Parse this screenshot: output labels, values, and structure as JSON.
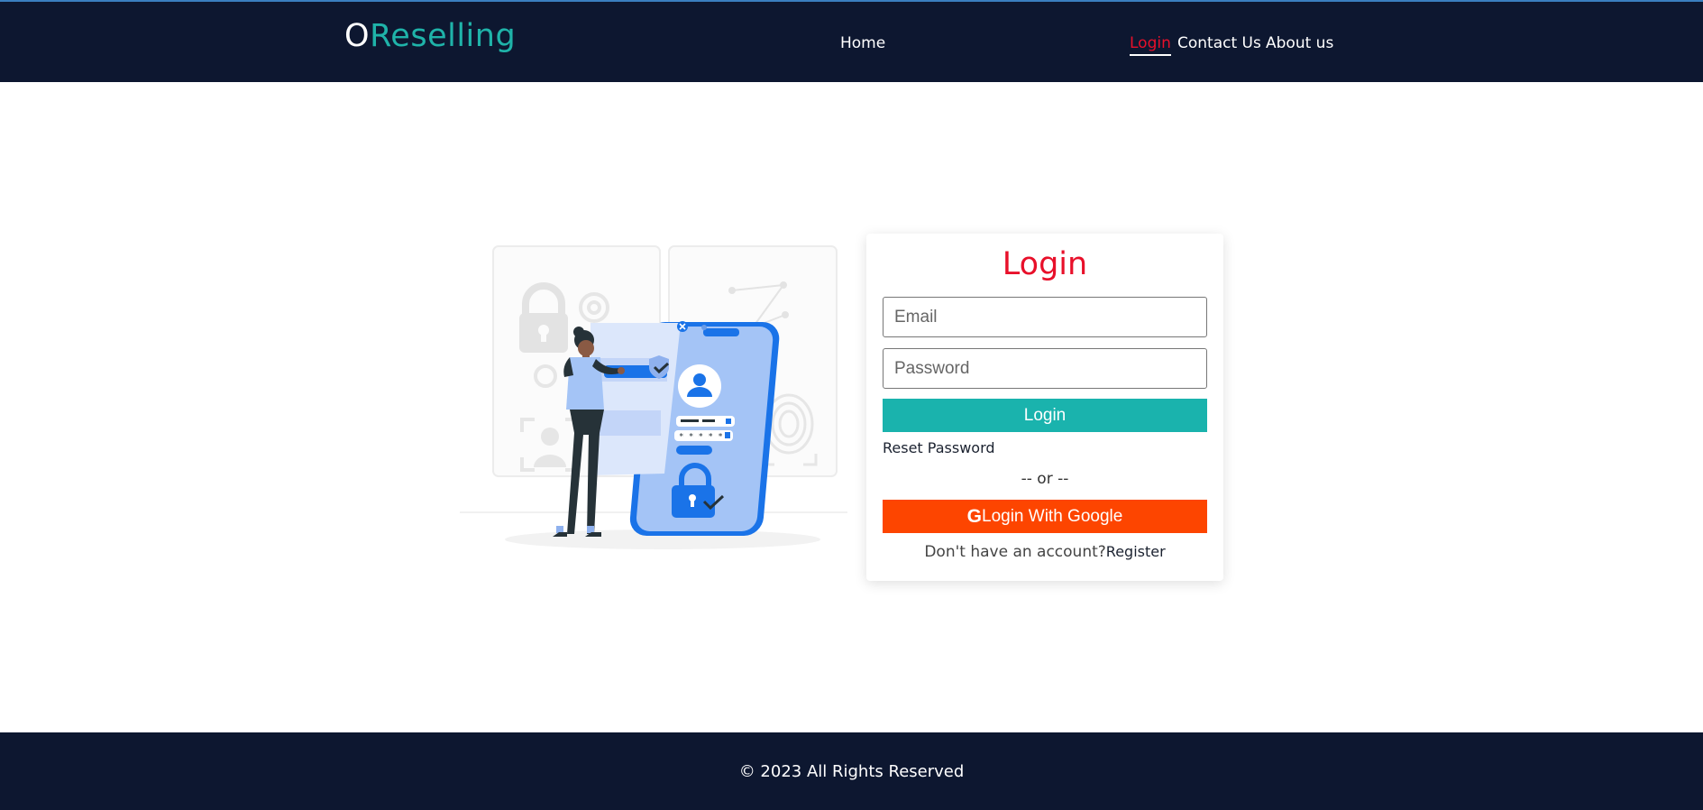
{
  "brand": {
    "first_letter": "O",
    "rest": "Reselling"
  },
  "nav": {
    "home": "Home",
    "login": "Login",
    "contact": "Contact Us",
    "about": "About us"
  },
  "login_card": {
    "title": "Login",
    "email_placeholder": "Email",
    "password_placeholder": "Password",
    "login_button": "Login",
    "reset_password": "Reset Password",
    "or_divider": "-- or --",
    "google_icon_letter": "G",
    "google_button": "Login With Google",
    "no_account_text": "Don't have an account?",
    "register_link": "Register"
  },
  "illustration": {
    "password_mask": "* * * * *"
  },
  "footer": {
    "text": "© 2023 All Rights Reserved"
  },
  "colors": {
    "navbar_bg": "#0d1730",
    "brand_teal": "#1fb3a9",
    "accent_red": "#e8102a",
    "login_button": "#1ab3ad",
    "google_button": "#fd4500",
    "illustration_blue": "#1a73e8"
  }
}
